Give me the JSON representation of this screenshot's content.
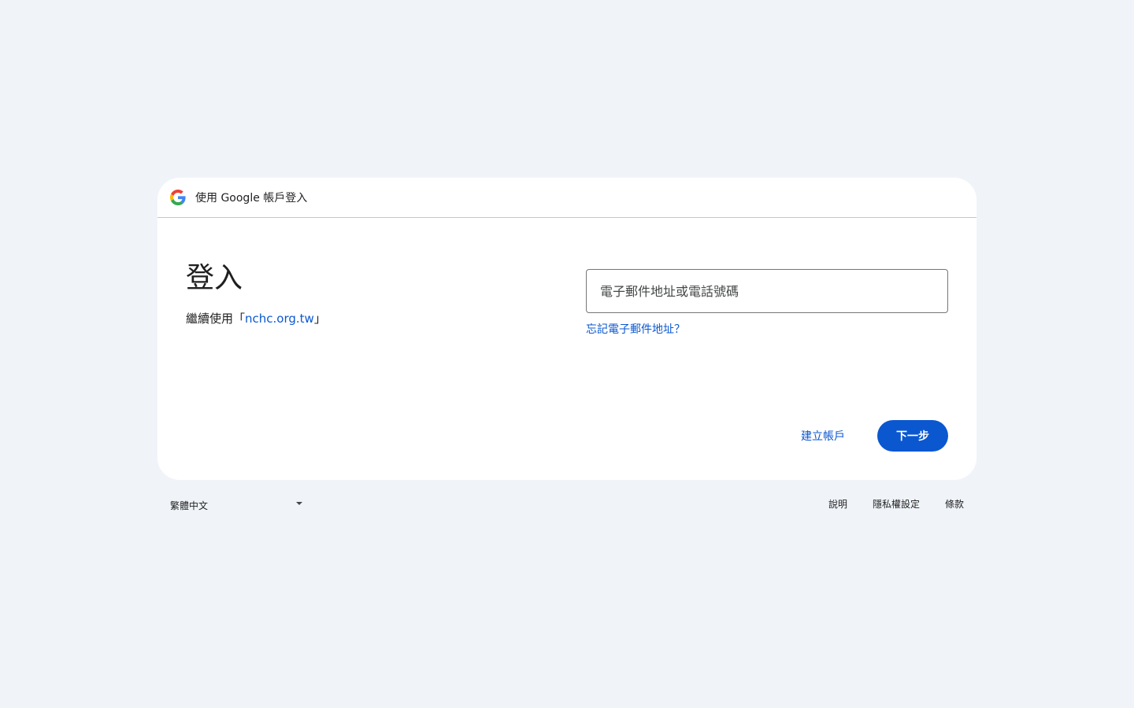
{
  "header": {
    "title": "使用 Google 帳戶登入",
    "logo_icon": "google-g-icon"
  },
  "main": {
    "title": "登入",
    "continue_prefix": "繼續使用「",
    "continue_link": "nchc.org.tw",
    "continue_suffix": "」"
  },
  "form": {
    "email_placeholder": "電子郵件地址或電話號碼",
    "email_value": "",
    "forgot_email": "忘記電子郵件地址？",
    "create_account": "建立帳戶",
    "next": "下一步"
  },
  "footer": {
    "language": "繁體中文",
    "help": "說明",
    "privacy": "隱私權設定",
    "terms": "條款"
  },
  "colors": {
    "background": "#f0f4f9",
    "card": "#ffffff",
    "accent": "#0b57d0",
    "text": "#1f1f1f"
  }
}
